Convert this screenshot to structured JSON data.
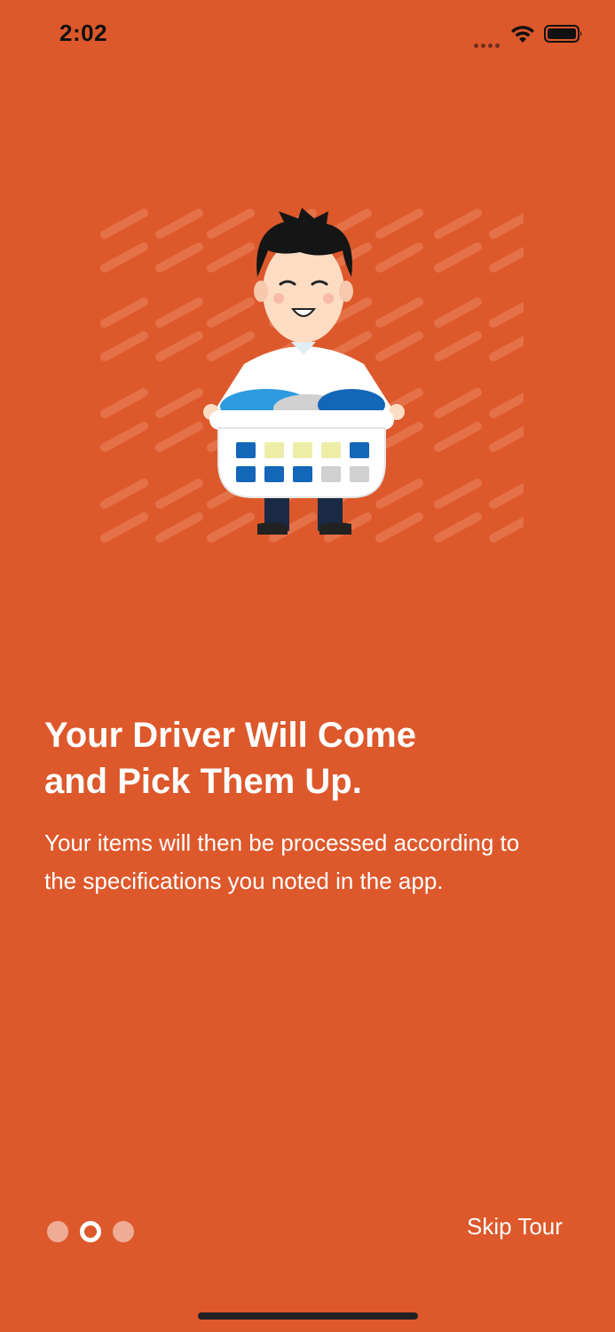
{
  "status_bar": {
    "time": "2:02",
    "signal_icon": "cellular-signal-icon",
    "wifi_icon": "wifi-icon",
    "battery_icon": "battery-icon"
  },
  "colors": {
    "background": "#DD582B",
    "text": "#FFFFFF",
    "status_text": "#111111",
    "stripe": "#E87A52",
    "shirt": "#FFFFFF",
    "hair": "#151515",
    "skin": "#FDDCC4",
    "pants": "#1A2A44",
    "basket": "#FFFFFF",
    "blue_laundry": "#2E9BE0",
    "dark_blue_laundry": "#1466B8",
    "yellow_laundry": "#EDEDA8",
    "grey_laundry": "#D0D0D0"
  },
  "illustration": {
    "icon": "man-holding-laundry-basket-illustration"
  },
  "onboarding": {
    "title_line_1": "Your Driver Will Come",
    "title_line_2": "and Pick Them Up.",
    "body_line_1": "Your items will then be processed according to",
    "body_line_2": "the specifications you noted in the app."
  },
  "pager": {
    "total_pages": 3,
    "current_page": 2
  },
  "actions": {
    "skip_label": "Skip Tour"
  }
}
